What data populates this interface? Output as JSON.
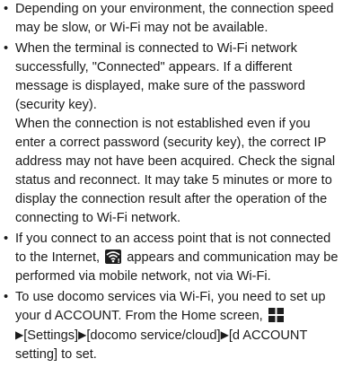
{
  "notes": [
    {
      "bullet": "•",
      "text": "Depending on your environment, the connection speed may be slow, or Wi-Fi may not be available."
    },
    {
      "bullet": "•",
      "text": "When the terminal is connected to Wi-Fi network successfully, \"Connected\" appears. If a different message is displayed, make sure of the password (security key).",
      "text2": "When the connection is not established even if you enter a correct password (security key), the correct IP address may not have been acquired. Check the signal status and reconnect. It may take 5 minutes or more to display the connection result after the operation of the connecting to Wi-Fi network."
    },
    {
      "bullet": "•",
      "text_before": "If you connect to an access point that is not connected to the Internet,",
      "icon": "wifi-no-internet-icon",
      "text_after": "appears and communication may be performed via mobile network, not via Wi-Fi."
    },
    {
      "bullet": "•",
      "text_before": "To use docomo services via Wi-Fi, you need to set up your d ACCOUNT. From the Home screen,",
      "icon": "apps-grid-icon",
      "arrow": "▶",
      "text_after_1": "[Settings]",
      "text_after_2": "[docomo service/cloud]",
      "text_after_3": "[d ACCOUNT setting] to set."
    }
  ]
}
